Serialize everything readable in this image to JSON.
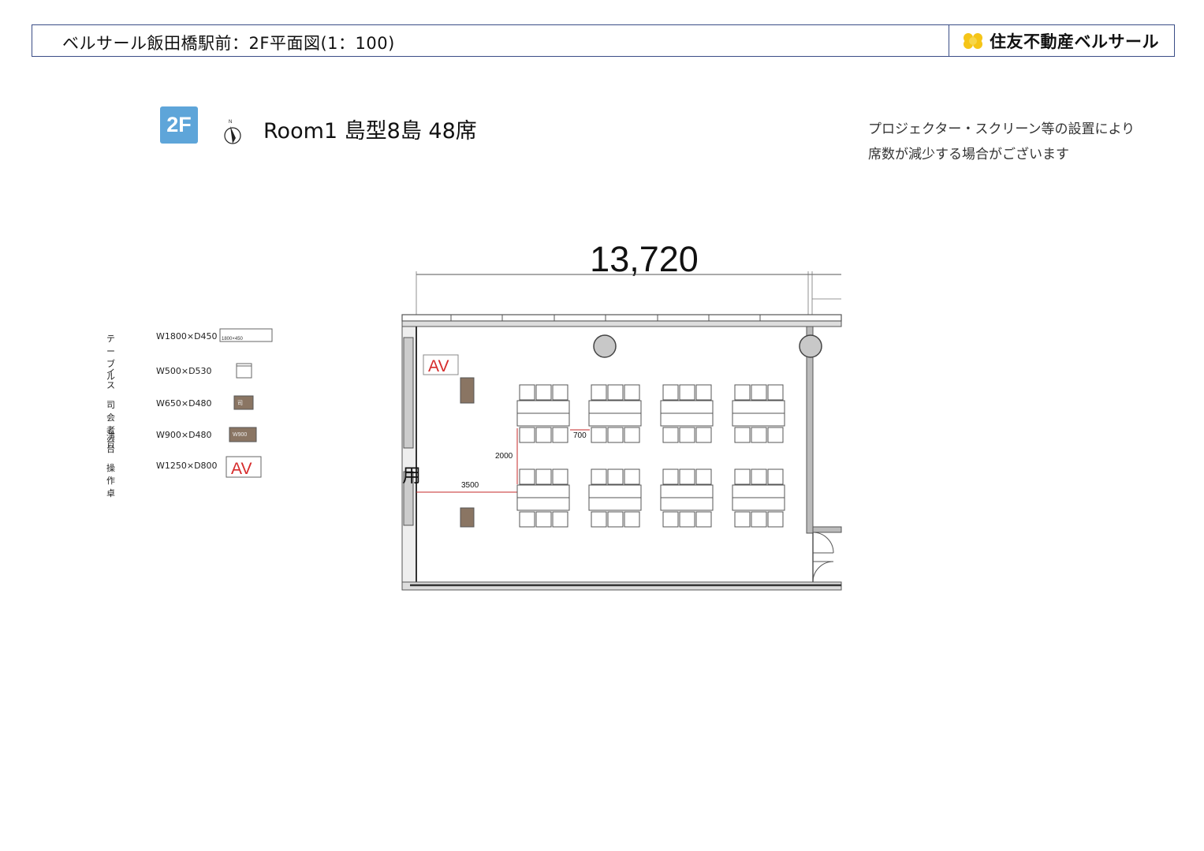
{
  "header": {
    "title": "ベルサール飯田橋駅前：2F平面図(1：100)",
    "brand": "住友不動産ベルサール",
    "brand_color": "#f5c518"
  },
  "floor_badge": "2F",
  "compass_label": "N",
  "room_title": "Room1 島型8島 48席",
  "notice": [
    "プロジェクター・スクリーン等の設置により",
    "席数が減少する場合がございます"
  ],
  "legend": [
    {
      "name": "テーブル",
      "dims": "W1800×D450",
      "symbol_label": "1800×450"
    },
    {
      "name": "イス",
      "dims": "W500×D530",
      "symbol_label": ""
    },
    {
      "name": "司会者台",
      "dims": "W650×D480",
      "symbol_label": "司"
    },
    {
      "name": "演台",
      "dims": "W900×D480",
      "symbol_label": "W900"
    },
    {
      "name": "操作卓",
      "dims": "W1250×D800",
      "symbol_label": "AV"
    }
  ],
  "plan": {
    "overall_width": "13,720",
    "av_label": "AV",
    "dim_row_gap": "700",
    "dim_vertical": "2000",
    "dim_horizontal": "3500",
    "side_glyph": "用",
    "islands_count": 8,
    "chairs_per_island": 6
  },
  "colors": {
    "badge": "#5ea5d9",
    "wall": "#555555",
    "av_red": "#d62b2b",
    "podium_brown": "#8a7563",
    "dim_red": "#c62828"
  }
}
